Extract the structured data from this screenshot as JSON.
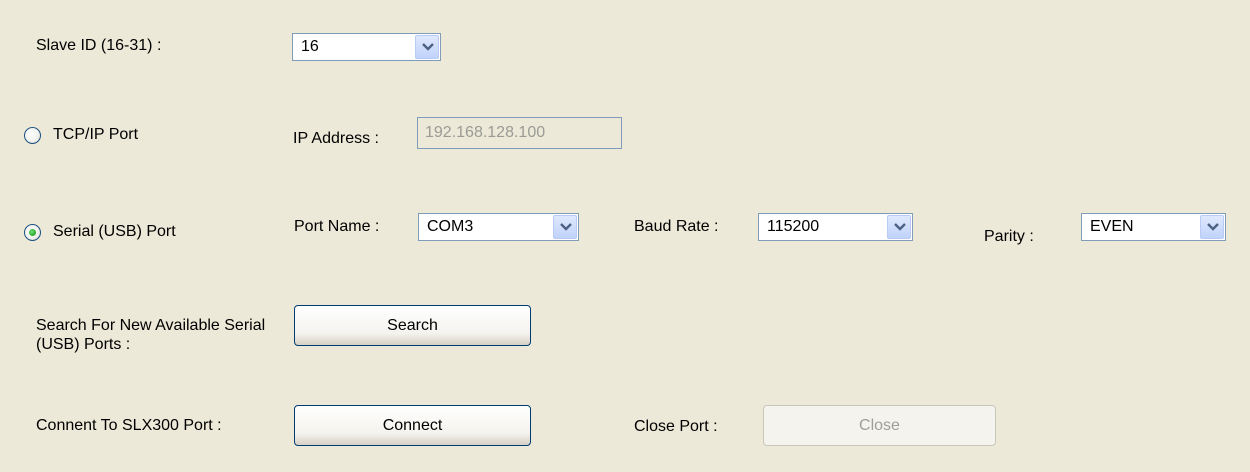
{
  "slave_id": {
    "label": "Slave ID (16-31) :",
    "value": "16"
  },
  "tcp": {
    "label": "TCP/IP Port",
    "selected": false,
    "ip_label": "IP Address :",
    "ip_value": "192.168.128.100"
  },
  "serial": {
    "label": "Serial (USB) Port",
    "selected": true,
    "port_name_label": "Port Name :",
    "port_name_value": "COM3",
    "baud_rate_label": "Baud Rate :",
    "baud_rate_value": "115200",
    "parity_label": "Parity :",
    "parity_value": "EVEN"
  },
  "search": {
    "label": "Search For New Available Serial (USB) Ports :",
    "button": "Search"
  },
  "connect": {
    "label": "Connent To SLX300 Port :",
    "button": "Connect",
    "close_label": "Close Port :",
    "close_button": "Close"
  },
  "icons": {
    "dropdown": "chevron-down-icon",
    "radio": "radio-icon"
  }
}
